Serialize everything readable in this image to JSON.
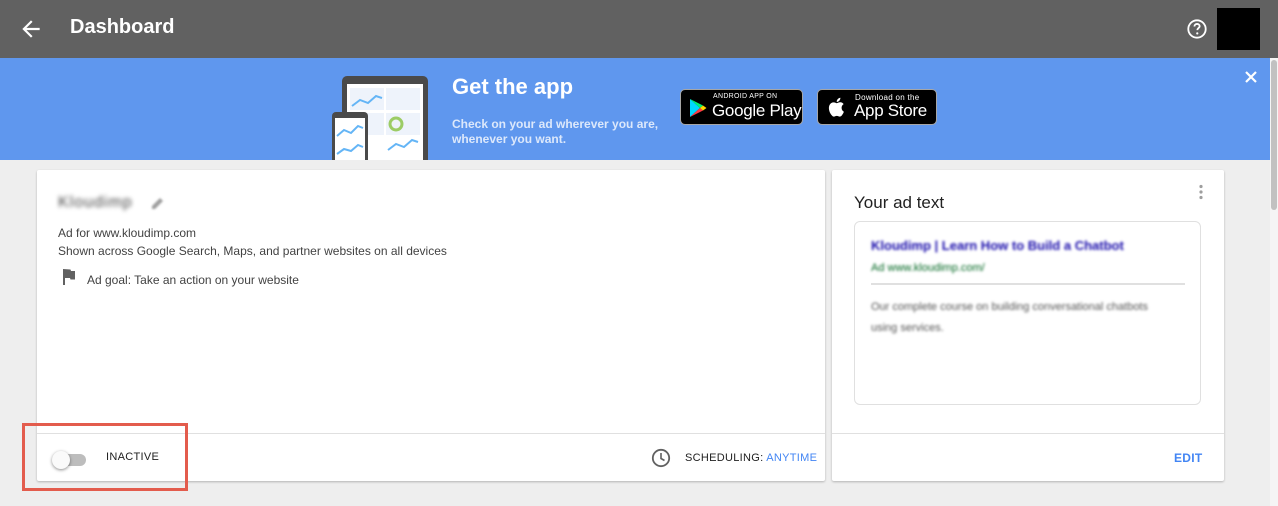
{
  "header": {
    "title": "Dashboard",
    "back_icon": "arrow-back-icon",
    "help_icon": "help-circle-icon"
  },
  "banner": {
    "title": "Get the app",
    "subtitle_line1": "Check on your ad wherever you are,",
    "subtitle_line2": "whenever you want.",
    "google_play": {
      "small": "ANDROID APP ON",
      "big": "Google Play"
    },
    "app_store": {
      "small": "Download on the",
      "big": "App Store"
    },
    "close_icon": "close-icon",
    "color": "#5f97ee"
  },
  "ad_card": {
    "name": "Kloudimp",
    "ad_for": "Ad for www.kloudimp.com",
    "shown": "Shown across Google Search, Maps, and partner websites on all devices",
    "goal": "Ad goal: Take an action on your website",
    "status": "INACTIVE",
    "scheduling_label": "SCHEDULING: ",
    "scheduling_value": "ANYTIME"
  },
  "ad_text_card": {
    "title": "Your ad text",
    "headline": "Kloudimp | Learn How to Build a Chatbot",
    "url": "Ad www.kloudimp.com/",
    "description": "Our complete course on building conversational chatbots using services.",
    "edit_label": "EDIT"
  },
  "colors": {
    "accent": "#4285f4",
    "highlight": "#e35c4d",
    "topbar": "#616161"
  }
}
